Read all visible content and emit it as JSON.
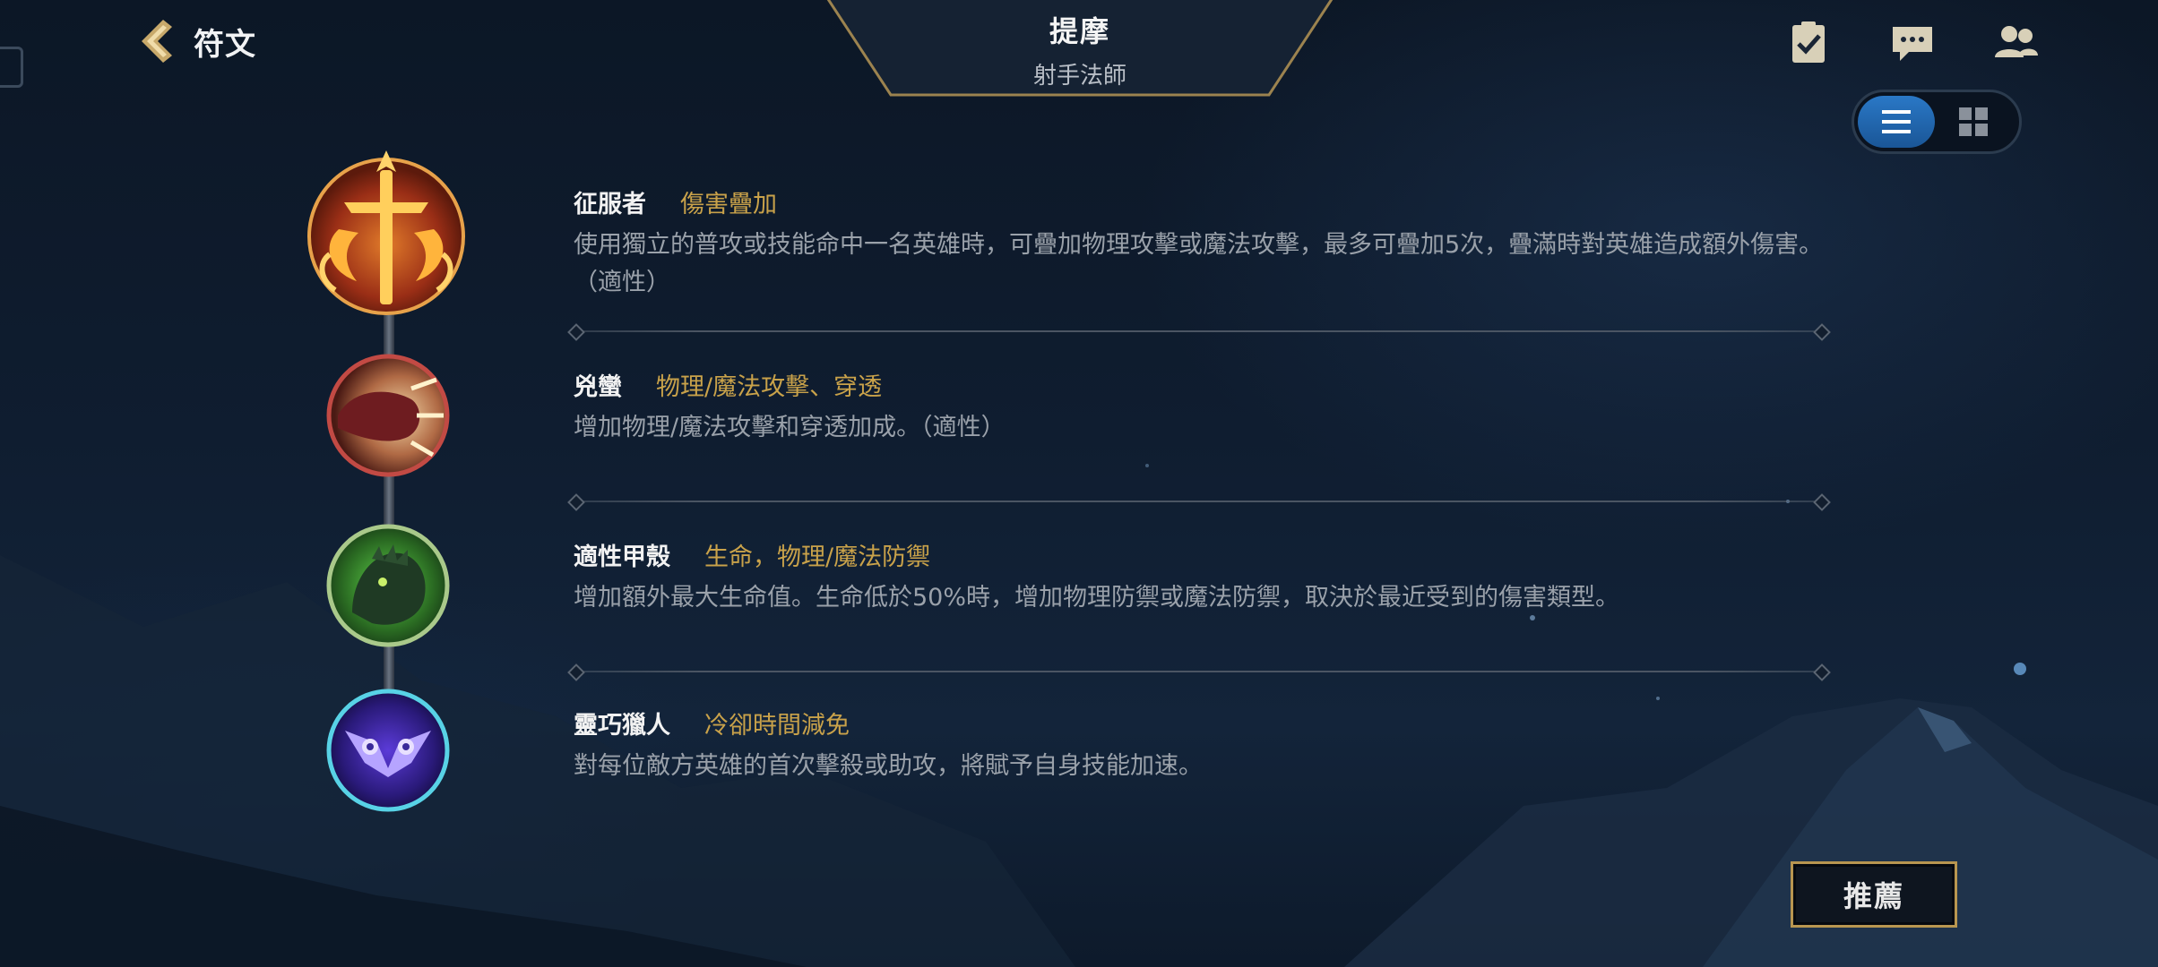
{
  "header": {
    "back_title": "符文",
    "champion_name": "提摩",
    "champion_role": "射手法師"
  },
  "top_right_icons": [
    "quest-clipboard-icon",
    "chat-icon",
    "friends-icon"
  ],
  "view_toggle": {
    "selected": "list",
    "options": [
      "list",
      "grid"
    ]
  },
  "runes": [
    {
      "name": "征服者",
      "tag": "傷害疊加",
      "description": "使用獨立的普攻或技能命中一名英雄時，可疊加物理攻擊或魔法攻擊，最多可疊加5次，疊滿時對英雄造成額外傷害。（適性）",
      "icon": "conqueror-icon"
    },
    {
      "name": "兇蠻",
      "tag": "物理/魔法攻擊、穿透",
      "description": "增加物理/魔法攻擊和穿透加成。（適性）",
      "icon": "brutal-icon"
    },
    {
      "name": "適性甲殼",
      "tag": "生命，物理/魔法防禦",
      "description": "增加額外最大生命值。生命低於50%時，增加物理防禦或魔法防禦，取決於最近受到的傷害類型。",
      "icon": "adaptive-carapace-icon"
    },
    {
      "name": "靈巧獵人",
      "tag": "冷卻時間減免",
      "description": "對每位敵方英雄的首次擊殺或助攻，將賦予自身技能加速。",
      "icon": "nimble-hunter-icon"
    }
  ],
  "recommend_button": "推薦",
  "colors": {
    "accent_gold": "#c9a24a",
    "toggle_blue": "#2a78c6",
    "background": "#0f1d30"
  }
}
